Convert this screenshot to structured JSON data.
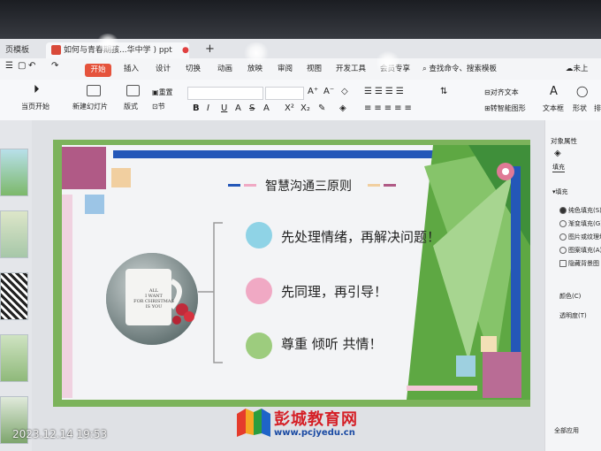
{
  "titlebar": {
    "left_tab": "页模板",
    "doc_tab": "如何与青春期孩...华中学 ) ppt",
    "new_tab_glyph": "+"
  },
  "menu": {
    "start": "开始",
    "items": [
      "插入",
      "设计",
      "切换",
      "动画",
      "放映",
      "审阅",
      "视图",
      "开发工具",
      "会员专享"
    ],
    "search": "查找命令、搜索模板",
    "sync": "未上"
  },
  "ribbon": {
    "play_from_current": "当页开始",
    "new_slide": "新建幻灯片",
    "layout": "版式",
    "section": "节",
    "reset": "重置",
    "align_text": "对齐文本",
    "smartart": "转智能图形",
    "textbox": "文本框",
    "shape": "形状",
    "arrange": "排"
  },
  "props_panel": {
    "title": "对象属性",
    "fill_tab": "填充",
    "fill_section": "填充",
    "options": [
      "纯色填充(S)",
      "渐变填充(G)",
      "图片或纹理填",
      "图案填充(A)",
      "隐藏背景图"
    ],
    "color": "颜色(C)",
    "transparency": "透明度(T)",
    "apply_all": "全部应用"
  },
  "slide": {
    "title": "智慧沟通三原则",
    "mug_text": [
      "ALL",
      "I WANT",
      "FOR CHRISTMAS",
      "IS YOU"
    ],
    "points": [
      {
        "text": "先处理情绪，再解决问题！",
        "color": "#8fd3e6"
      },
      {
        "text": "先同理，再引导！",
        "color": "#f0a9c4"
      },
      {
        "text": "尊重  倾听  共情！",
        "color": "#9dcc7e"
      }
    ]
  },
  "timestamp": "2023.12.14 19:53",
  "watermark": {
    "name": "彭城教育网",
    "url": "www.pcjyedu.cn"
  },
  "colors": {
    "accent_green": "#6aa84f",
    "accent_blue": "#2457b8",
    "accent_pink": "#d99ab8",
    "start_red": "#e5533c"
  }
}
